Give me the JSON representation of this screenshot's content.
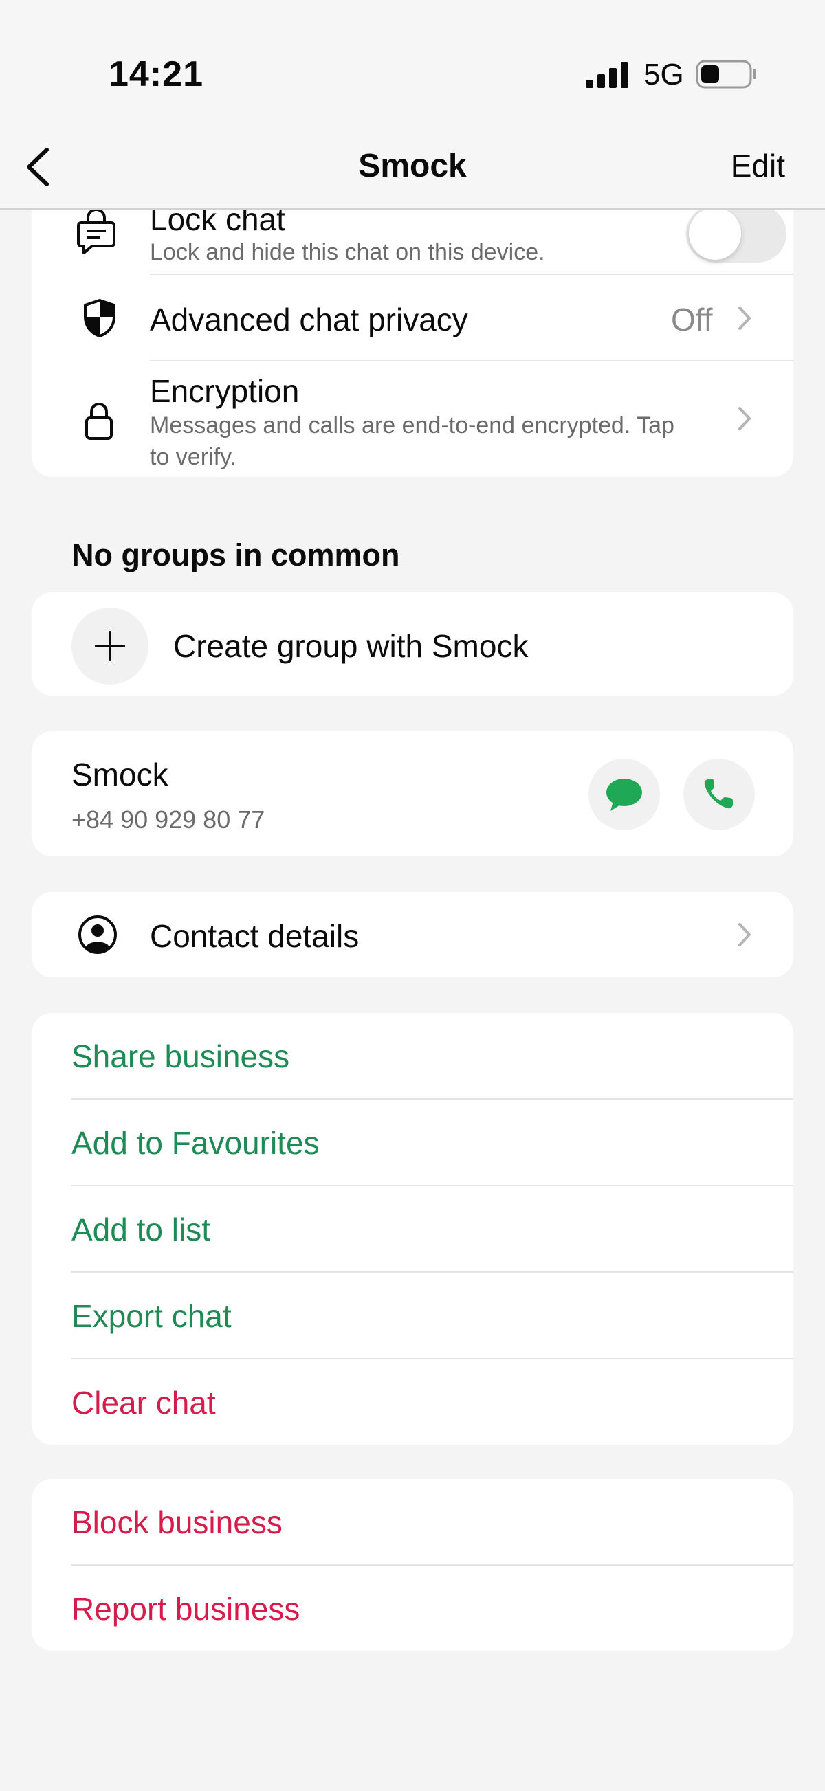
{
  "status_bar": {
    "time": "14:21",
    "network": "5G"
  },
  "nav": {
    "title": "Smock",
    "edit_label": "Edit"
  },
  "privacy_card": {
    "lock_chat": {
      "title": "Lock chat",
      "subtitle": "Lock and hide this chat on this device.",
      "enabled": false
    },
    "advanced_privacy": {
      "title": "Advanced chat privacy",
      "value": "Off"
    },
    "encryption": {
      "title": "Encryption",
      "subtitle_line1": "Messages and calls are end-to-end encrypted. Tap",
      "subtitle_line2": "to verify."
    }
  },
  "groups": {
    "header": "No groups in common",
    "create_label": "Create group with Smock"
  },
  "contact": {
    "name": "Smock",
    "phone": "+84 90 929 80 77"
  },
  "contact_details_label": "Contact details",
  "actions": {
    "share": "Share business",
    "favourites": "Add to Favourites",
    "list": "Add to list",
    "export": "Export chat",
    "clear": "Clear chat"
  },
  "danger": {
    "block": "Block business",
    "report": "Report business"
  },
  "colors": {
    "accent_green": "#1e8a54",
    "destructive_red": "#d41d4b",
    "background": "#f4f4f4",
    "card": "#ffffff"
  },
  "icons": [
    "signal-icon",
    "battery-icon",
    "back-chevron-icon",
    "lock-chat-icon",
    "shield-icon",
    "padlock-icon",
    "plus-icon",
    "message-icon",
    "phone-icon",
    "person-circle-icon",
    "chevron-right-icon"
  ]
}
